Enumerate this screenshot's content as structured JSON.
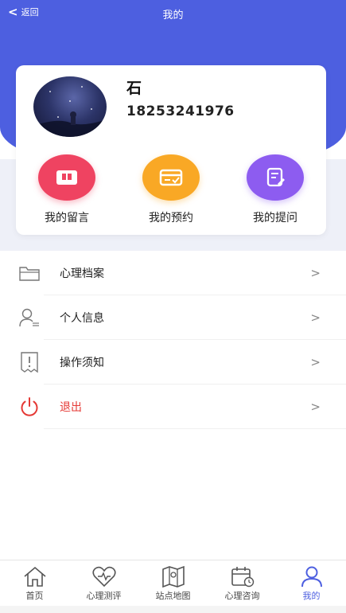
{
  "topbar": {
    "back_label": "返回",
    "title": "我的"
  },
  "profile": {
    "name": "石",
    "phone": "18253241976"
  },
  "actions": [
    {
      "label": "我的留言",
      "icon": "message-box-icon",
      "color": "#ef4361"
    },
    {
      "label": "我的预约",
      "icon": "appointment-card-icon",
      "color": "#f9a825"
    },
    {
      "label": "我的提问",
      "icon": "question-edit-icon",
      "color": "#8d5cf0"
    }
  ],
  "menu": [
    {
      "label": "心理档案",
      "arrow": ">",
      "icon": "folder-icon"
    },
    {
      "label": "个人信息",
      "arrow": ">",
      "icon": "user-info-icon"
    },
    {
      "label": "操作须知",
      "arrow": ">",
      "icon": "notice-icon"
    },
    {
      "label": "退出",
      "arrow": ">",
      "icon": "power-icon",
      "color": "#e53935"
    }
  ],
  "tabs": [
    {
      "label": "首页",
      "icon": "home-icon"
    },
    {
      "label": "心理测评",
      "icon": "heart-pulse-icon"
    },
    {
      "label": "站点地图",
      "icon": "map-icon"
    },
    {
      "label": "心理咨询",
      "icon": "calendar-clock-icon"
    },
    {
      "label": "我的",
      "icon": "user-icon",
      "active": true
    }
  ],
  "colors": {
    "primary": "#4d5fe0",
    "danger": "#e53935"
  }
}
